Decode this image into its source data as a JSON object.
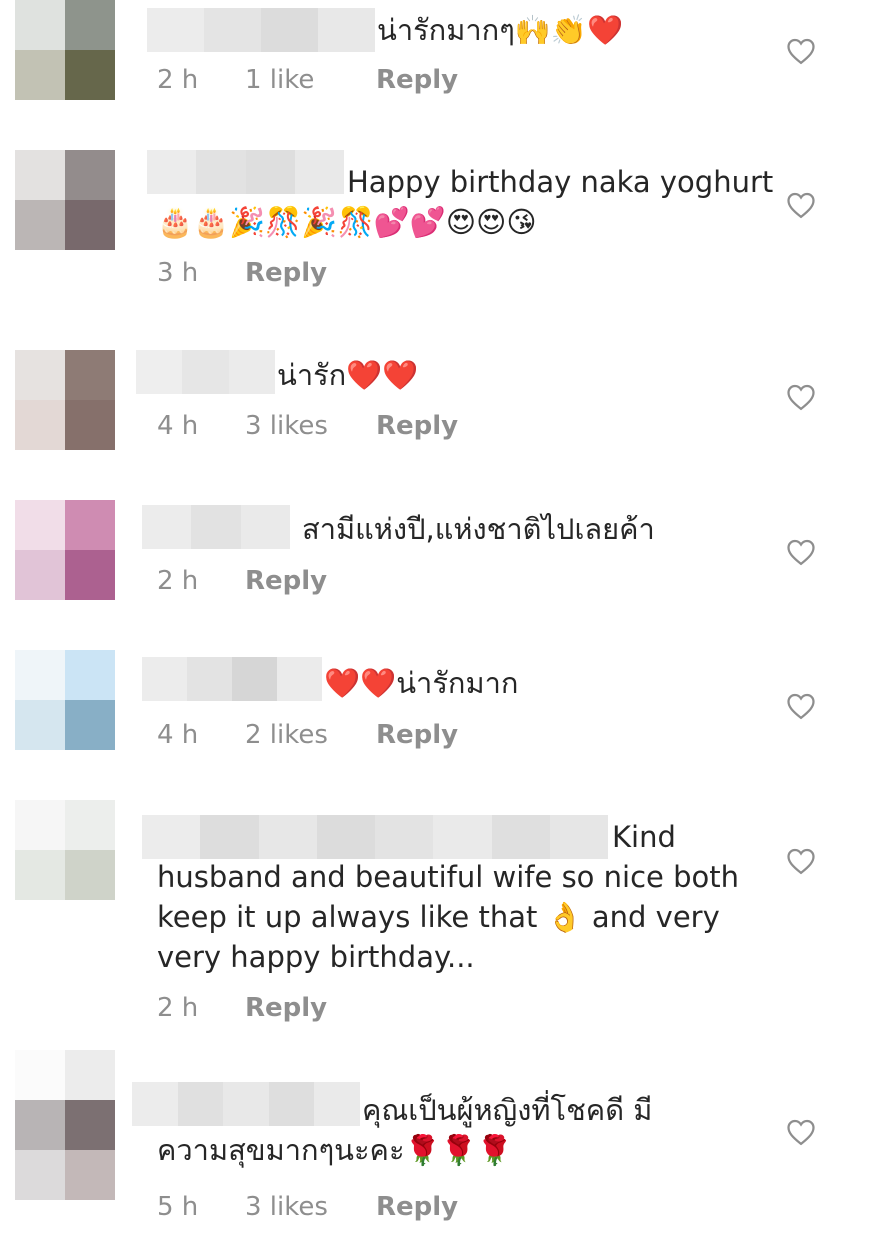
{
  "colors": {
    "text": "#262626",
    "meta": "#8e8e8e",
    "heart_outline": "#8e8e8e"
  },
  "comments": [
    {
      "text": "น่ารักมากๆ🙌👏❤️",
      "time": "2 h",
      "likes": "1 like",
      "reply": "Reply",
      "like_icon": "heart-outline-icon"
    },
    {
      "text": "Happy birthday naka yoghurt 🎂🎂🎉🎊🎉🎊💕💕😍😍😘",
      "time": "3 h",
      "likes": "",
      "reply": "Reply",
      "like_icon": "heart-outline-icon"
    },
    {
      "text": "น่ารัก❤️❤️",
      "time": "4 h",
      "likes": "3 likes",
      "reply": "Reply",
      "like_icon": "heart-outline-icon"
    },
    {
      "text": "สามีแห่งปี,แห่งชาติไปเลยค้า",
      "time": "2 h",
      "likes": "",
      "reply": "Reply",
      "like_icon": "heart-outline-icon"
    },
    {
      "text": "❤️❤️น่ารักมาก",
      "time": "4 h",
      "likes": "2 likes",
      "reply": "Reply",
      "like_icon": "heart-outline-icon"
    },
    {
      "text": "Kind husband and beautiful wife so nice both keep it up always like that 👌 and very very happy birthday...",
      "time": "2 h",
      "likes": "",
      "reply": "Reply",
      "like_icon": "heart-outline-icon"
    },
    {
      "text": "คุณเป็นผู้หญิงที่โชคดี มีความสุขมากๆนะคะ🌹🌹🌹",
      "time": "5 h",
      "likes": "3 likes",
      "reply": "Reply",
      "like_icon": "heart-outline-icon"
    }
  ]
}
